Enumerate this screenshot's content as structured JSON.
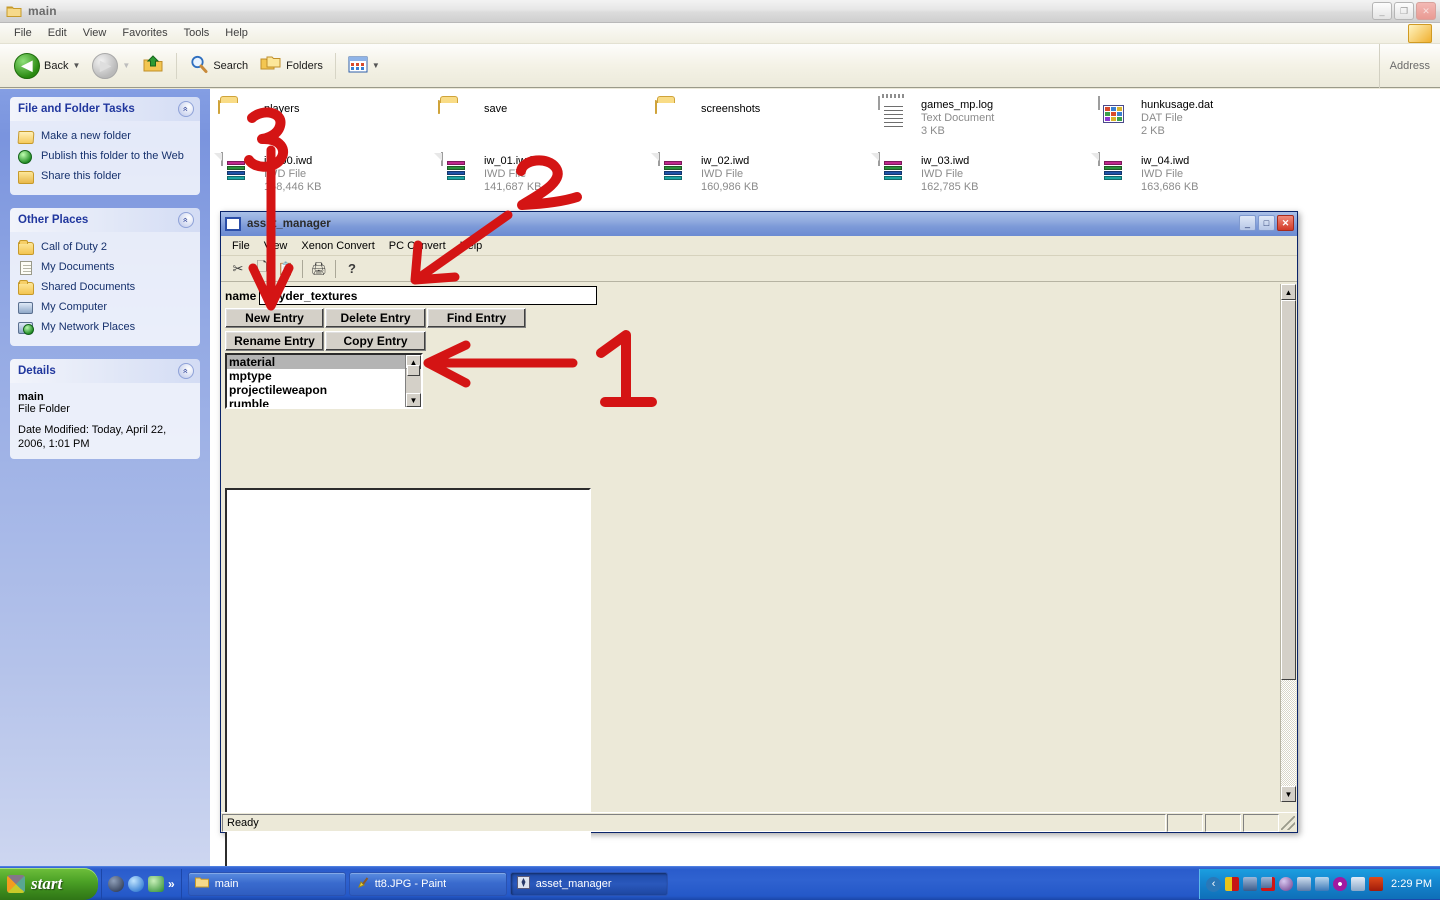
{
  "explorer": {
    "title": "main",
    "title_icon": "folder-icon",
    "menu": [
      "File",
      "Edit",
      "View",
      "Favorites",
      "Tools",
      "Help"
    ],
    "window_buttons": {
      "minimize": "_",
      "maximize": "❐",
      "close": "✕"
    },
    "toolbar": {
      "back_label": "Back",
      "search_label": "Search",
      "folders_label": "Folders",
      "address_label": "Address",
      "icons": [
        "back-arrow-icon",
        "forward-arrow-icon",
        "up-folder-icon",
        "search-icon",
        "folders-icon",
        "views-icon"
      ]
    }
  },
  "sidebar": {
    "panels": [
      {
        "title": "File and Folder Tasks",
        "collapse_glyph": "«",
        "items": [
          {
            "label": "Make a new folder",
            "icon": "new-folder-icon"
          },
          {
            "label": "Publish this folder to the Web",
            "icon": "publish-web-icon"
          },
          {
            "label": "Share this folder",
            "icon": "share-folder-icon"
          }
        ]
      },
      {
        "title": "Other Places",
        "collapse_glyph": "«",
        "items": [
          {
            "label": "Call of Duty 2",
            "icon": "folder-icon"
          },
          {
            "label": "My Documents",
            "icon": "documents-icon"
          },
          {
            "label": "Shared Documents",
            "icon": "folder-icon"
          },
          {
            "label": "My Computer",
            "icon": "computer-icon"
          },
          {
            "label": "My Network Places",
            "icon": "network-icon"
          }
        ]
      }
    ],
    "details": {
      "title": "Details",
      "collapse_glyph": "«",
      "name": "main",
      "type": "File Folder",
      "date": "Date Modified: Today, April 22, 2006, 1:01 PM"
    }
  },
  "files": [
    {
      "name": "players",
      "type": "",
      "size": "",
      "icon": "folder-icon"
    },
    {
      "name": "save",
      "type": "",
      "size": "",
      "icon": "folder-icon"
    },
    {
      "name": "screenshots",
      "type": "",
      "size": "",
      "icon": "folder-icon"
    },
    {
      "name": "games_mp.log",
      "type": "Text Document",
      "size": "3 KB",
      "icon": "text-document-icon"
    },
    {
      "name": "hunkusage.dat",
      "type": "DAT File",
      "size": "2 KB",
      "icon": "dat-file-icon"
    },
    {
      "name": "iw_00.iwd",
      "type": "IWD File",
      "size": "158,446 KB",
      "icon": "iwd-archive-icon"
    },
    {
      "name": "iw_01.iwd",
      "type": "IWD File",
      "size": "141,687 KB",
      "icon": "iwd-archive-icon"
    },
    {
      "name": "iw_02.iwd",
      "type": "IWD File",
      "size": "160,986 KB",
      "icon": "iwd-archive-icon"
    },
    {
      "name": "iw_03.iwd",
      "type": "IWD File",
      "size": "162,785 KB",
      "icon": "iwd-archive-icon"
    },
    {
      "name": "iw_04.iwd",
      "type": "IWD File",
      "size": "163,686 KB",
      "icon": "iwd-archive-icon"
    }
  ],
  "asset_manager": {
    "title": "asset_manager",
    "window_buttons": {
      "minimize": "_",
      "maximize": "□",
      "close": "✕"
    },
    "menu": [
      "File",
      "View",
      "Xenon Convert",
      "PC Convert",
      "Help"
    ],
    "toolbar_icons": [
      "cut-icon",
      "copy-icon",
      "paste-icon",
      "print-icon",
      "help-icon"
    ],
    "form": {
      "name_label": "name",
      "name_value": "stryder_textures",
      "buttons_row1": [
        "New Entry",
        "Delete Entry",
        "Find Entry"
      ],
      "buttons_row2": [
        "Rename Entry",
        "Copy Entry"
      ]
    },
    "entry_list": {
      "items": [
        "material",
        "mptype",
        "projectileweapon",
        "rumble"
      ],
      "selected": "material"
    },
    "status": {
      "text": "Ready",
      "panes": [
        "",
        "",
        ""
      ]
    }
  },
  "annotations": [
    {
      "label": "1",
      "color": "#d41414",
      "target": "entry-list-scrollbar"
    },
    {
      "label": "2",
      "color": "#d41414",
      "target": "name-input"
    },
    {
      "label": "3",
      "color": "#d41414",
      "target": "new-entry-button"
    }
  ],
  "taskbar": {
    "start_label": "start",
    "quicklaunch_icons": [
      "netscape-icon",
      "internet-explorer-icon",
      "media-icon"
    ],
    "quicklaunch_overflow": "»",
    "tasks": [
      {
        "label": "main",
        "icon": "folder-icon",
        "active": false
      },
      {
        "label": "tt8.JPG - Paint",
        "icon": "paint-icon",
        "active": false
      },
      {
        "label": "asset_manager",
        "icon": "app-icon",
        "active": true
      }
    ],
    "tray": {
      "expand_glyph": "‹",
      "icons": [
        "zonealarm-icon",
        "network-icon",
        "network-disconnect-icon",
        "sound-icon",
        "printer-icon",
        "monitor-icon",
        "disc-icon",
        "display-icon",
        "ati-icon"
      ],
      "clock": "2:29 PM"
    }
  },
  "colors": {
    "desktop_blue": "#5a7edc",
    "taskbar_blue": "#2a5ccc",
    "annotation_red": "#d41414",
    "titlebar_blue": "#7d9ad8"
  }
}
